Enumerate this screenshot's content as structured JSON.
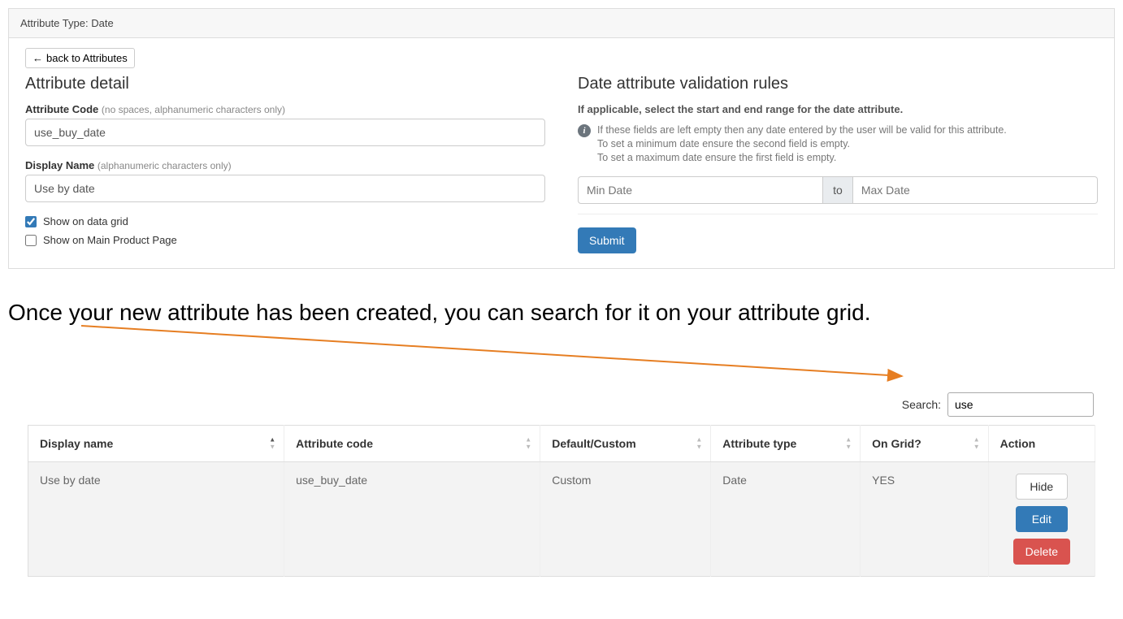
{
  "panel": {
    "header_prefix": "Attribute Type:",
    "header_value": "Date",
    "back_button": "back to Attributes"
  },
  "detail": {
    "heading": "Attribute detail",
    "code": {
      "label": "Attribute Code",
      "hint": "(no spaces, alphanumeric characters only)",
      "value": "use_buy_date"
    },
    "display_name": {
      "label": "Display Name",
      "hint": "(alphanumeric characters only)",
      "value": "Use by date"
    },
    "show_on_grid": {
      "label": "Show on data grid",
      "checked": true
    },
    "show_on_main": {
      "label": "Show on Main Product Page",
      "checked": false
    }
  },
  "validation": {
    "heading": "Date attribute validation rules",
    "subheading": "If applicable, select the start and end range for the date attribute.",
    "info_line1": "If these fields are left empty then any date entered by the user will be valid for this attribute.",
    "info_line2": "To set a minimum date ensure the second field is empty.",
    "info_line3": "To set a maximum date ensure the first field is empty.",
    "min_placeholder": "Min Date",
    "to_label": "to",
    "max_placeholder": "Max Date",
    "submit_label": "Submit"
  },
  "doc": {
    "note": "Once your new attribute has been created, you can search for it on your attribute grid."
  },
  "search": {
    "label": "Search:",
    "value": "use"
  },
  "grid": {
    "columns": {
      "display_name": "Display name",
      "attribute_code": "Attribute code",
      "default_custom": "Default/Custom",
      "attribute_type": "Attribute type",
      "on_grid": "On Grid?",
      "action": "Action"
    },
    "row": {
      "display_name": "Use by date",
      "attribute_code": "use_buy_date",
      "default_custom": "Custom",
      "attribute_type": "Date",
      "on_grid": "YES"
    },
    "actions": {
      "hide": "Hide",
      "edit": "Edit",
      "delete": "Delete"
    }
  }
}
